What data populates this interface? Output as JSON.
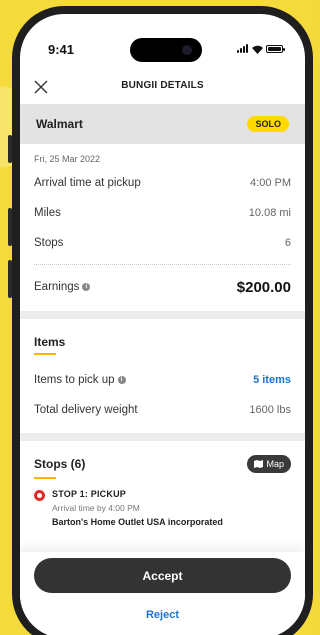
{
  "status_bar": {
    "time": "9:41"
  },
  "header": {
    "title": "BUNGII DETAILS",
    "close_icon": "close-icon"
  },
  "shop": {
    "name": "Walmart",
    "badge": "SOLO"
  },
  "summary": {
    "date": "Fri, 25 Mar 2022",
    "rows": [
      {
        "label": "Arrival time at pickup",
        "value": "4:00 PM"
      },
      {
        "label": "Miles",
        "value": "10.08 mi"
      },
      {
        "label": "Stops",
        "value": "6"
      }
    ],
    "earnings_label": "Earnings",
    "earnings_value": "$200.00"
  },
  "items": {
    "title": "Items",
    "pickup_label": "Items to pick up",
    "pickup_value": "5 items",
    "weight_label": "Total delivery weight",
    "weight_value": "1600 lbs"
  },
  "stops": {
    "title": "Stops (6)",
    "map_label": "Map",
    "list": [
      {
        "title": "STOP 1: PICKUP",
        "time": "Arrival time by 4:00 PM",
        "address": "Barton's Home Outlet USA incorporated"
      }
    ]
  },
  "actions": {
    "accept": "Accept",
    "reject": "Reject"
  },
  "colors": {
    "accent": "#ffd900",
    "link": "#1b73d1",
    "button": "#333333",
    "background": "#f5da3b"
  }
}
